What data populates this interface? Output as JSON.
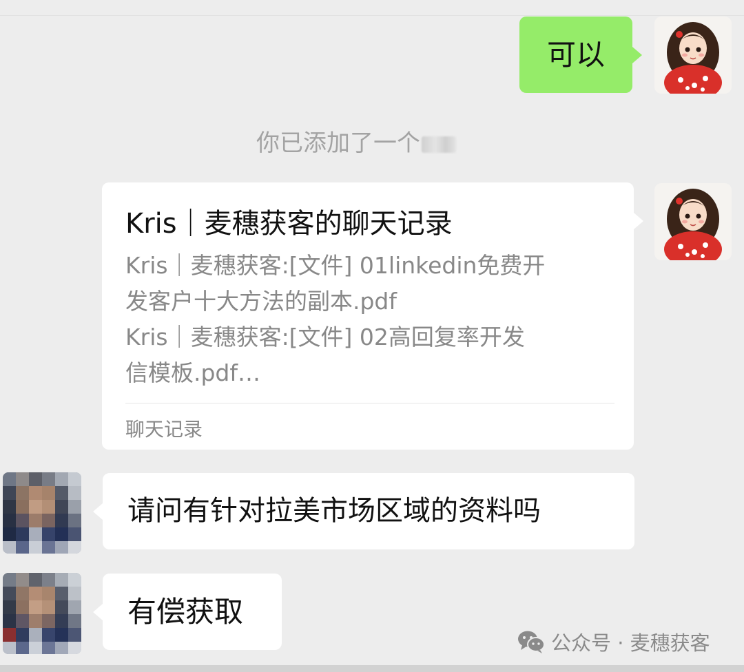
{
  "messages": {
    "ok": "可以",
    "system": "你已添加了一个",
    "card": {
      "title": "Kris｜麦穗获客的聊天记录",
      "lines": [
        "Kris｜麦穗获客:[文件] 01linkedin免费开",
        "发客户十大方法的副本.pdf",
        "Kris｜麦穗获客:[文件] 02高回复率开发",
        "信模板.pdf…"
      ],
      "footer": "聊天记录"
    },
    "question": "请问有针对拉美市场区域的资料吗",
    "reply": "有偿获取"
  },
  "watermark": {
    "text": "公众号 · 麦穗获客",
    "icon": "wechat-icon"
  },
  "colors": {
    "background": "#ededed",
    "self_bubble": "#95ec69",
    "other_bubble": "#ffffff"
  }
}
